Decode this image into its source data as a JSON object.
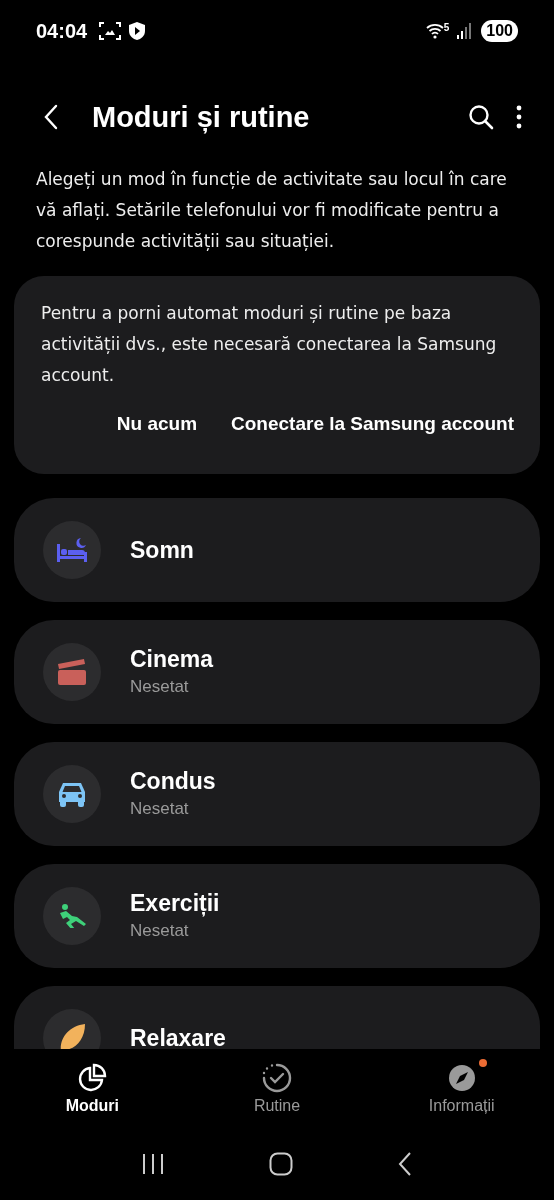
{
  "status_bar": {
    "time": "04:04",
    "wifi_label": "5",
    "battery": "100"
  },
  "header": {
    "title": "Moduri și rutine"
  },
  "description": "Alegeți un mod în funcție de activitate sau locul în care vă aflați. Setările telefonului vor fi modificate pentru a corespunde activității sau situației.",
  "account_card": {
    "message": "Pentru a porni automat moduri și rutine pe baza activității dvs., este necesară conectarea la Samsung account.",
    "buttons": [
      "Nu acum",
      "Conectare la Samsung account"
    ]
  },
  "modes": [
    {
      "name": "Somn",
      "color": "#5b5ff0"
    },
    {
      "name": "Cinema",
      "subtitle": "Nesetat",
      "color": "#c9605a"
    },
    {
      "name": "Condus",
      "subtitle": "Nesetat",
      "color": "#7dc4f5"
    },
    {
      "name": "Exerciții",
      "subtitle": "Nesetat",
      "color": "#3ed17a"
    },
    {
      "name": "Relaxare",
      "color": "#f2b25c"
    }
  ],
  "tabs": [
    {
      "label": "Moduri",
      "selected": true,
      "badge": false
    },
    {
      "label": "Rutine",
      "selected": false,
      "badge": false
    },
    {
      "label": "Informații",
      "selected": false,
      "badge": true
    }
  ]
}
